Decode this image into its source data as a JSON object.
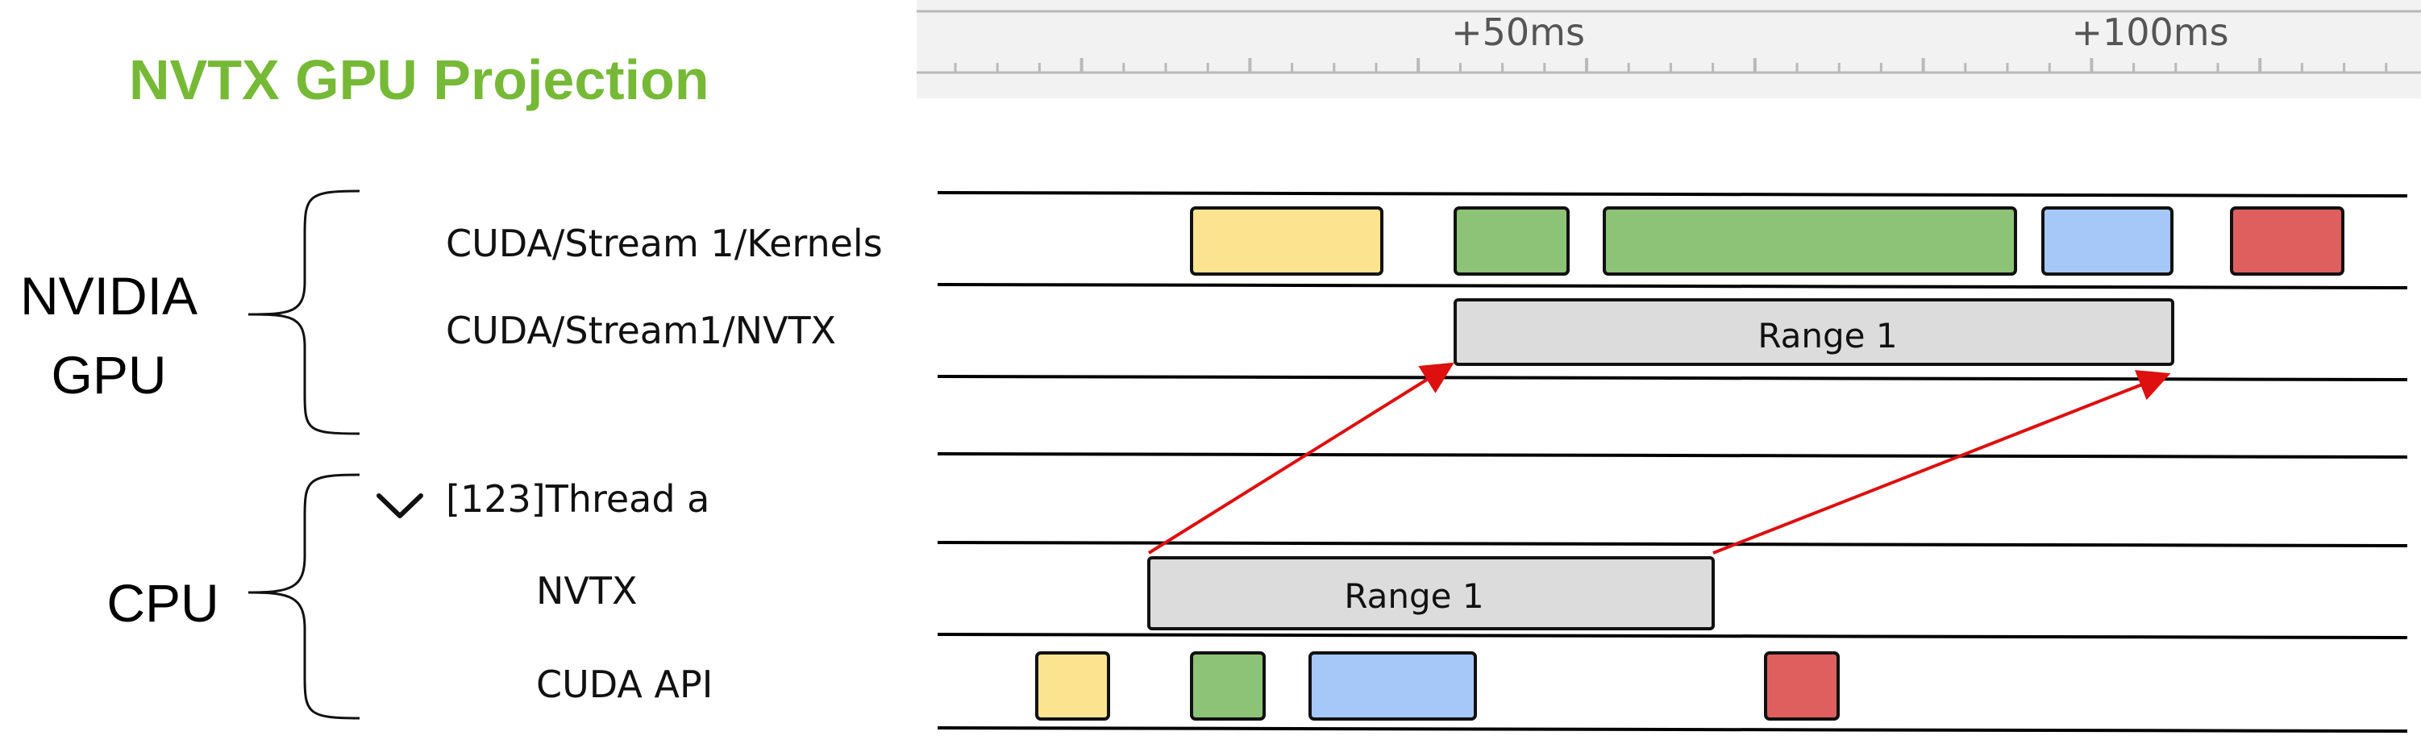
{
  "title": "NVTX GPU Projection",
  "colors": {
    "title": "#76b936",
    "yellow": "#fce38f",
    "green": "#8dc377",
    "blue": "#a6c8f9",
    "red": "#df5f5f",
    "range": "#dcdcdc",
    "arrow": "#dd0f0f",
    "ruler_bg": "#f2f2f2"
  },
  "timeline": {
    "ticks": [
      "+50ms",
      "+100ms"
    ]
  },
  "groups": [
    {
      "label": [
        "NVIDIA",
        "GPU"
      ],
      "icon": "brace-icon"
    },
    {
      "label": [
        "CPU"
      ],
      "icon": "brace-icon"
    }
  ],
  "tracks": [
    {
      "label": "CUDA/Stream 1/Kernels"
    },
    {
      "label": "CUDA/Stream1/NVTX"
    },
    {
      "label": "[123]Thread a",
      "icon": "chevron-down-icon"
    },
    {
      "label": "NVTX"
    },
    {
      "label": "CUDA API"
    }
  ],
  "ranges": [
    {
      "track": "CUDA/Stream1/NVTX",
      "label": "Range 1"
    },
    {
      "track": "NVTX",
      "label": "Range 1"
    }
  ],
  "arrows": {
    "icon": "arrow-icon",
    "from": "NVTX Range 1",
    "to": "CUDA/Stream1/NVTX Range 1"
  }
}
